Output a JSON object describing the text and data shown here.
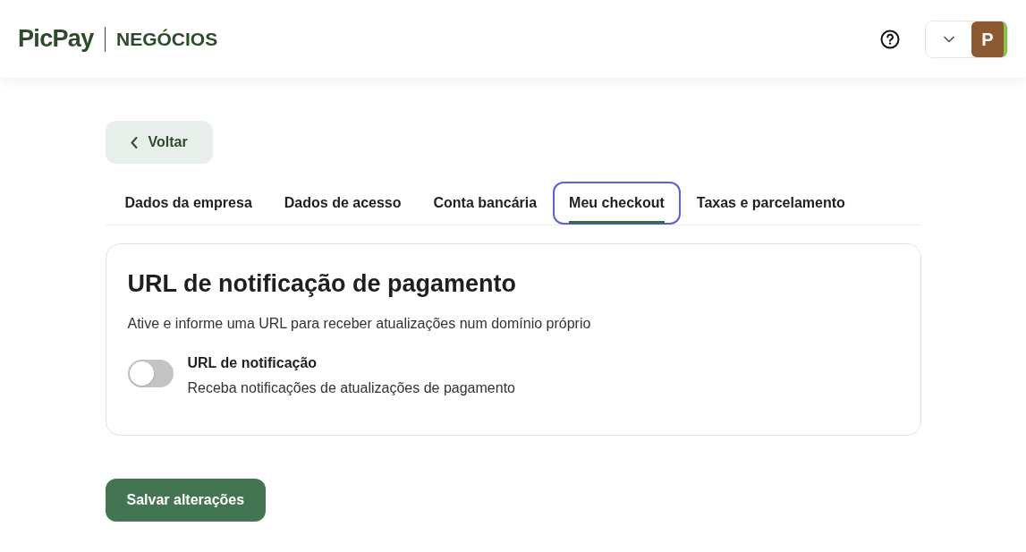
{
  "header": {
    "logo": "PicPay",
    "logo_suffix": "NEGÓCIOS",
    "avatar_letter": "P"
  },
  "back_button": {
    "label": "Voltar"
  },
  "tabs": [
    {
      "label": "Dados da empresa",
      "selected": false,
      "focused": false
    },
    {
      "label": "Dados de acesso",
      "selected": false,
      "focused": false
    },
    {
      "label": "Conta bancária",
      "selected": false,
      "focused": false
    },
    {
      "label": "Meu checkout",
      "selected": true,
      "focused": true
    },
    {
      "label": "Taxas e parcelamento",
      "selected": false,
      "focused": false
    }
  ],
  "card": {
    "title": "URL de notificação de pagamento",
    "description": "Ative e informe uma URL para receber atualizações num domínio próprio",
    "toggle": {
      "label": "URL de notificação",
      "hint": "Receba notificações de atualizações de pagamento",
      "on": false
    }
  },
  "save_button": {
    "label": "Salvar alterações"
  }
}
